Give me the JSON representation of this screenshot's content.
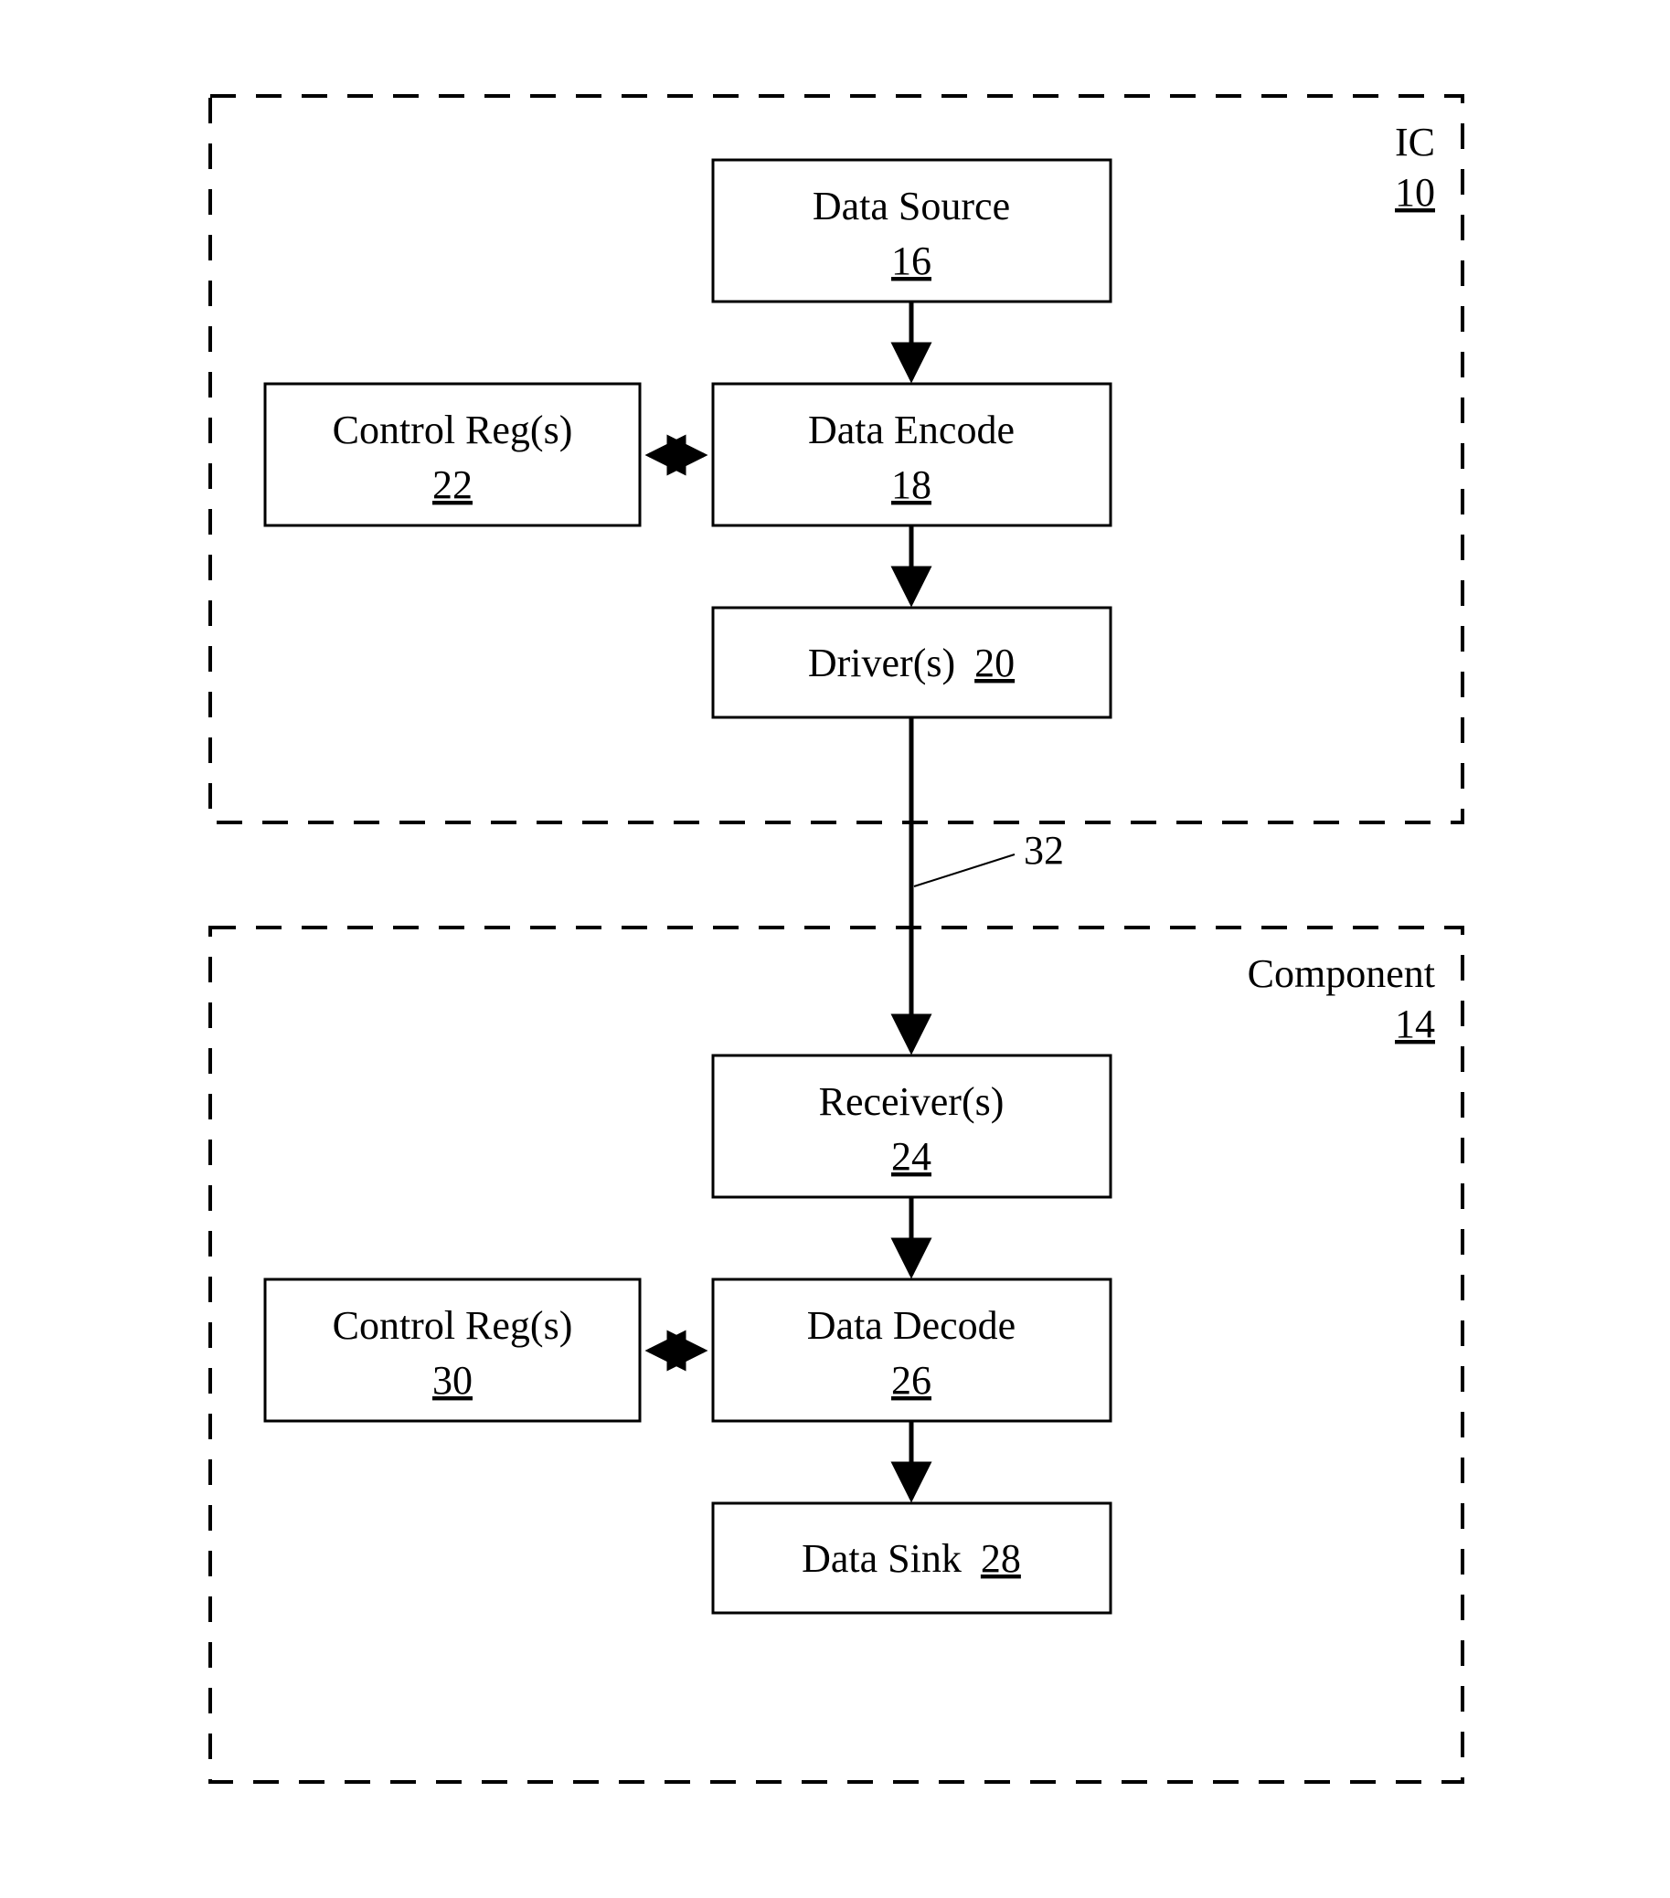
{
  "containers": {
    "ic": {
      "label": "IC",
      "ref": "10"
    },
    "component": {
      "label": "Component",
      "ref": "14"
    }
  },
  "blocks": {
    "data_source": {
      "label": "Data Source",
      "ref": "16"
    },
    "data_encode": {
      "label": "Data Encode",
      "ref": "18"
    },
    "drivers": {
      "label": "Driver(s)",
      "ref": "20"
    },
    "ctrl_regs_a": {
      "label": "Control Reg(s)",
      "ref": "22"
    },
    "receivers": {
      "label": "Receiver(s)",
      "ref": "24"
    },
    "data_decode": {
      "label": "Data Decode",
      "ref": "26"
    },
    "data_sink": {
      "label": "Data Sink",
      "ref": "28"
    },
    "ctrl_regs_b": {
      "label": "Control Reg(s)",
      "ref": "30"
    }
  },
  "wire_label": "32"
}
